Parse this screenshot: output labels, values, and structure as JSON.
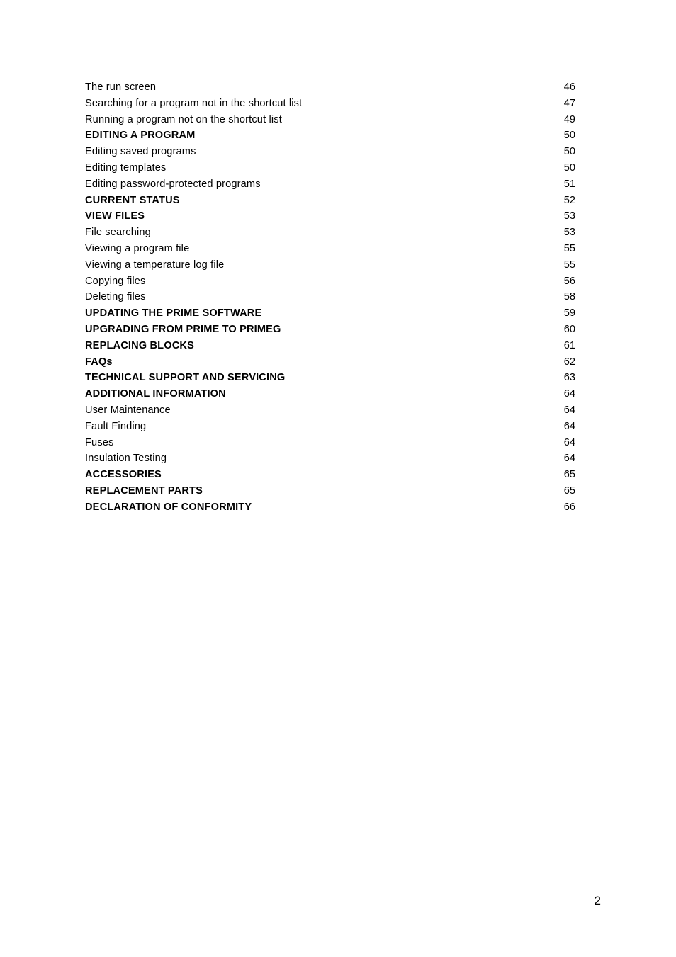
{
  "document": {
    "page_number": "2",
    "text_color": "#000000",
    "background_color": "#ffffff"
  },
  "toc": {
    "entries": [
      {
        "label": "The run screen",
        "page": "46",
        "level": "sub"
      },
      {
        "label": "Searching for a program not in the shortcut list",
        "page": "47",
        "level": "sub"
      },
      {
        "label": "Running a program not on the shortcut list",
        "page": "49",
        "level": "sub"
      },
      {
        "label": "EDITING A PROGRAM",
        "page": "50",
        "level": "section"
      },
      {
        "label": "Editing saved programs",
        "page": "50",
        "level": "sub"
      },
      {
        "label": "Editing templates",
        "page": "50",
        "level": "sub"
      },
      {
        "label": "Editing password-protected programs",
        "page": "51",
        "level": "sub"
      },
      {
        "label": "CURRENT STATUS",
        "page": "52",
        "level": "section"
      },
      {
        "label": "VIEW FILES",
        "page": "53",
        "level": "section"
      },
      {
        "label": "File searching",
        "page": "53",
        "level": "sub"
      },
      {
        "label": "Viewing a program file",
        "page": "55",
        "level": "sub"
      },
      {
        "label": "Viewing a temperature log file",
        "page": "55",
        "level": "sub"
      },
      {
        "label": "Copying files",
        "page": "56",
        "level": "sub"
      },
      {
        "label": "Deleting files",
        "page": "58",
        "level": "sub"
      },
      {
        "label": "UPDATING THE PRIME SOFTWARE",
        "page": "59",
        "level": "section"
      },
      {
        "label": "UPGRADING FROM PRIME TO PRIMEG",
        "page": "60",
        "level": "section"
      },
      {
        "label": "REPLACING BLOCKS",
        "page": "61",
        "level": "section"
      },
      {
        "label": "FAQs",
        "page": "62",
        "level": "section"
      },
      {
        "label": "TECHNICAL SUPPORT AND SERVICING",
        "page": "63",
        "level": "section"
      },
      {
        "label": "ADDITIONAL INFORMATION",
        "page": "64",
        "level": "section"
      },
      {
        "label": "User Maintenance",
        "page": "64",
        "level": "sub"
      },
      {
        "label": "Fault Finding",
        "page": "64",
        "level": "sub"
      },
      {
        "label": "Fuses",
        "page": "64",
        "level": "sub"
      },
      {
        "label": "Insulation Testing",
        "page": "64",
        "level": "sub"
      },
      {
        "label": "ACCESSORIES",
        "page": "65",
        "level": "section"
      },
      {
        "label": "REPLACEMENT PARTS",
        "page": "65",
        "level": "section"
      },
      {
        "label": "DECLARATION OF CONFORMITY",
        "page": "66",
        "level": "section"
      }
    ]
  }
}
